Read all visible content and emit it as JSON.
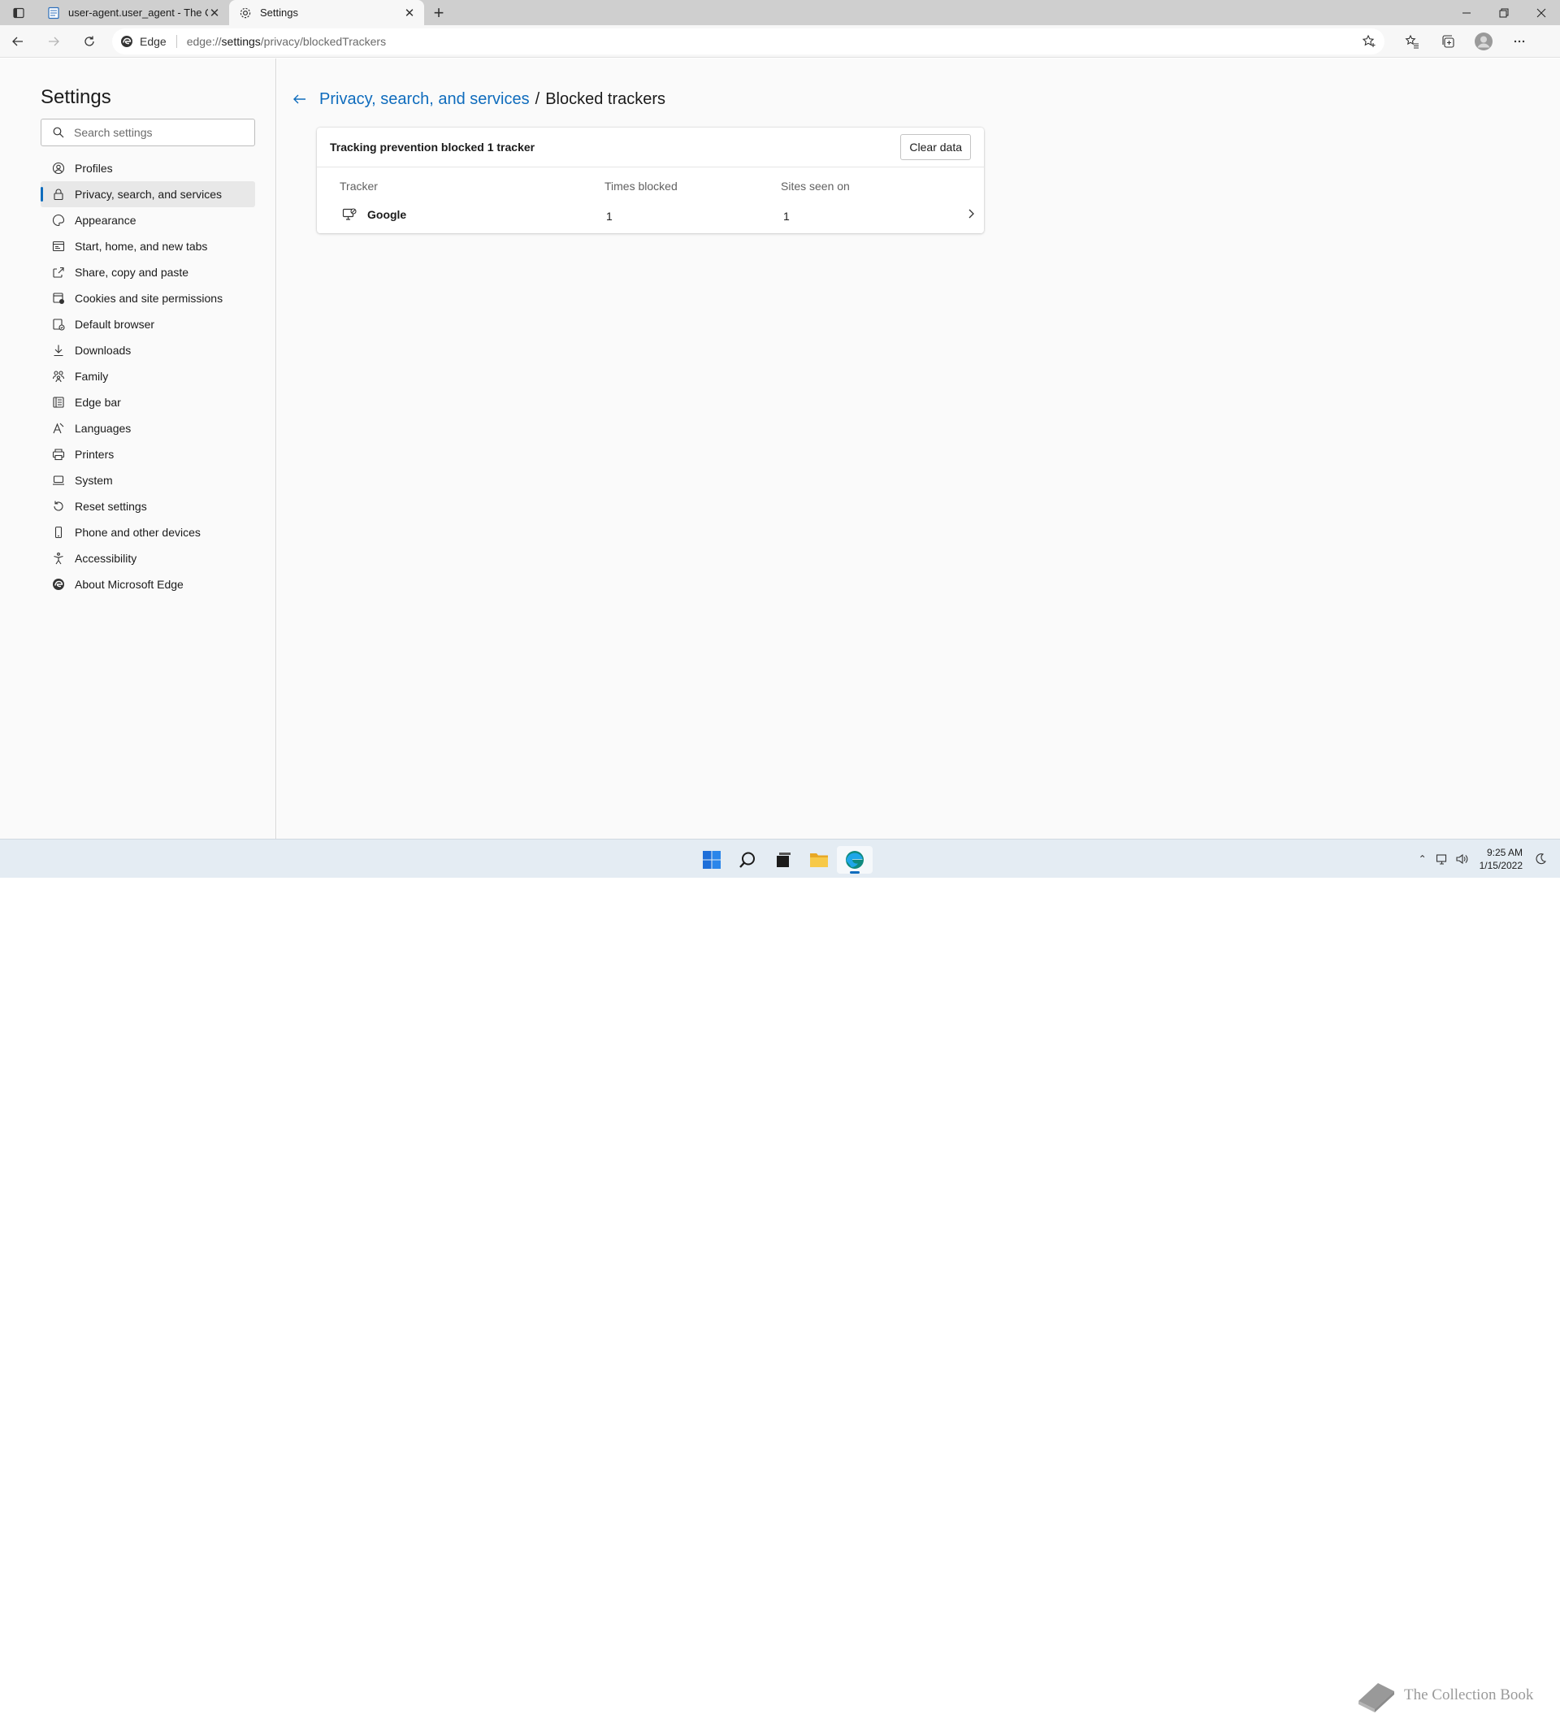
{
  "tabs": [
    {
      "title": "user-agent.user_agent - The Coll",
      "icon": "document-icon",
      "active": false
    },
    {
      "title": "Settings",
      "icon": "gear-icon",
      "active": true
    }
  ],
  "toolbar": {
    "site_identity": "Edge",
    "url_prefix": "edge://",
    "url_host": "settings",
    "url_path": "/privacy/blockedTrackers"
  },
  "sidebar": {
    "title": "Settings",
    "search_placeholder": "Search settings",
    "items": [
      {
        "label": "Profiles",
        "icon": "profile-icon"
      },
      {
        "label": "Privacy, search, and services",
        "icon": "lock-icon",
        "selected": true
      },
      {
        "label": "Appearance",
        "icon": "appearance-icon"
      },
      {
        "label": "Start, home, and new tabs",
        "icon": "start-icon"
      },
      {
        "label": "Share, copy and paste",
        "icon": "share-icon"
      },
      {
        "label": "Cookies and site permissions",
        "icon": "cookie-icon"
      },
      {
        "label": "Default browser",
        "icon": "browser-icon"
      },
      {
        "label": "Downloads",
        "icon": "download-icon"
      },
      {
        "label": "Family",
        "icon": "family-icon"
      },
      {
        "label": "Edge bar",
        "icon": "edgebar-icon"
      },
      {
        "label": "Languages",
        "icon": "language-icon"
      },
      {
        "label": "Printers",
        "icon": "printer-icon"
      },
      {
        "label": "System",
        "icon": "system-icon"
      },
      {
        "label": "Reset settings",
        "icon": "reset-icon"
      },
      {
        "label": "Phone and other devices",
        "icon": "phone-icon"
      },
      {
        "label": "Accessibility",
        "icon": "accessibility-icon"
      },
      {
        "label": "About Microsoft Edge",
        "icon": "edge-logo-icon"
      }
    ]
  },
  "main": {
    "breadcrumb_parent": "Privacy, search, and services",
    "breadcrumb_separator": "/",
    "breadcrumb_current": "Blocked trackers",
    "summary": "Tracking prevention blocked 1 tracker",
    "clear_button": "Clear data",
    "columns": {
      "tracker": "Tracker",
      "times_blocked": "Times blocked",
      "sites_seen_on": "Sites seen on"
    },
    "rows": [
      {
        "tracker": "Google",
        "times_blocked": "1",
        "sites_seen_on": "1"
      }
    ]
  },
  "taskbar": {
    "time": "9:25 AM",
    "date": "1/15/2022",
    "watermark": "The Collection Book"
  },
  "colors": {
    "accent": "#0f6cbd",
    "tabstrip": "#cfcfcf",
    "taskbar": "#e4ecf3"
  }
}
